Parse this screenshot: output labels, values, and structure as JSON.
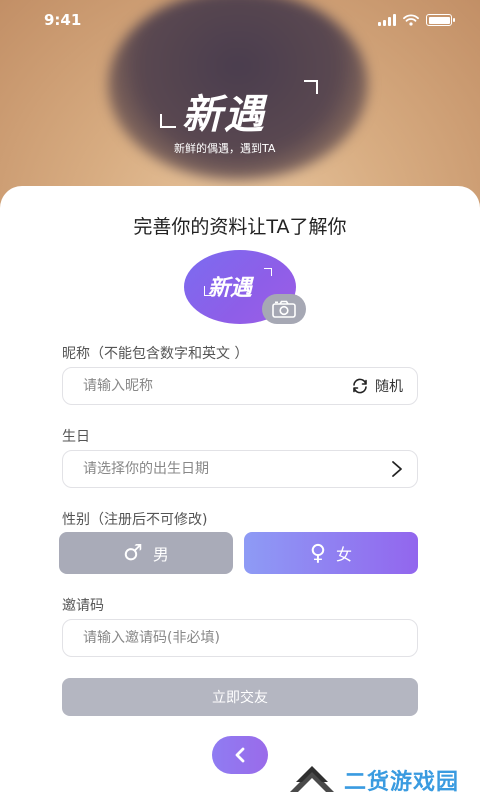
{
  "status_bar": {
    "time": "9:41"
  },
  "hero": {
    "logo": "新遇",
    "tagline": "新鲜的偶遇，遇到TA"
  },
  "card": {
    "title": "完善你的资料让TA了解你"
  },
  "avatar": {
    "logo": "新遇"
  },
  "nickname": {
    "label": "昵称（不能包含数字和英文 ）",
    "placeholder": "请输入昵称",
    "random_label": "随机"
  },
  "birthday": {
    "label": "生日",
    "placeholder": "请选择你的出生日期"
  },
  "gender": {
    "label": "性别（注册后不可修改)",
    "male_symbol": "♂",
    "male_label": "男",
    "female_symbol": "♀",
    "female_label": "女",
    "selected": "女"
  },
  "invite": {
    "label": "邀请码",
    "placeholder": "请输入邀请码(非必填)"
  },
  "submit": {
    "label": "立即交友"
  },
  "watermark": {
    "text": "二货游戏园"
  },
  "colors": {
    "accent": "#9266ee",
    "accent_light": "#8e9bf5",
    "disabled": "#b4b6c1",
    "male_bg": "#a9abb8"
  }
}
